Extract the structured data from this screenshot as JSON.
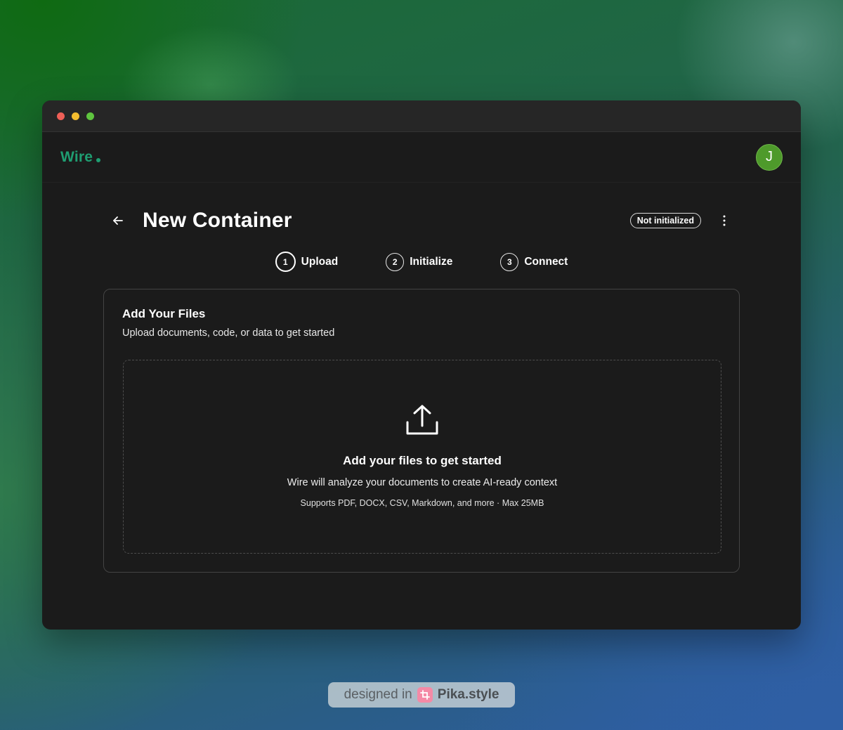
{
  "app": {
    "logo_text": "Wire",
    "avatar_initial": "J"
  },
  "header": {
    "title": "New Container",
    "status": "Not initialized"
  },
  "steps": [
    {
      "number": "1",
      "label": "Upload"
    },
    {
      "number": "2",
      "label": "Initialize"
    },
    {
      "number": "3",
      "label": "Connect"
    }
  ],
  "card": {
    "title": "Add Your Files",
    "subtitle": "Upload documents, code, or data to get started",
    "dropzone": {
      "title": "Add your files to get started",
      "description": "Wire will analyze your documents to create AI-ready context",
      "support": "Supports PDF, DOCX, CSV, Markdown, and more · Max 25MB"
    }
  },
  "watermark": {
    "prefix": "designed in",
    "brand": "Pika.style"
  },
  "colors": {
    "brand": "#1f9e72",
    "avatar": "#4e9a2b",
    "window_bg": "#1b1b1b"
  },
  "icons": [
    "arrow-left-icon",
    "more-vertical-icon",
    "upload-icon",
    "pika-logo-icon"
  ]
}
